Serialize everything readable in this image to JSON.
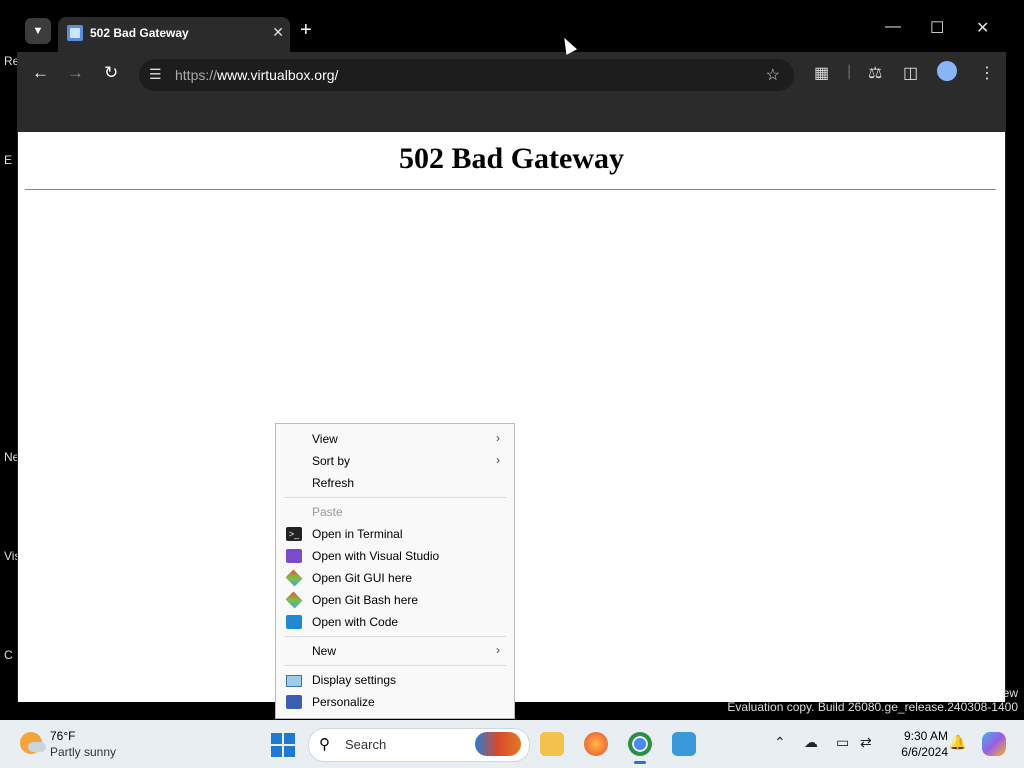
{
  "desktop": {
    "icon_labels": [
      "Re",
      "E",
      "Ne",
      "Vis",
      "C"
    ]
  },
  "browser": {
    "tab": {
      "title": "502 Bad Gateway"
    },
    "address": {
      "scheme": "https://",
      "host": "www.virtualbox.org/"
    },
    "icons": {
      "tab_search": "chevron-down-icon",
      "back": "arrow-left-icon",
      "forward": "arrow-right-icon",
      "reload": "reload-icon",
      "site_info": "tune-icon",
      "bookmark": "star-icon",
      "extensions": "puzzle-icon",
      "labs": "flask-icon",
      "side_panel": "side-panel-icon",
      "profile": "avatar-icon",
      "menu": "kebab-icon"
    }
  },
  "page": {
    "heading": "502 Bad Gateway"
  },
  "context_menu": {
    "items": [
      {
        "label": "View",
        "submenu": true
      },
      {
        "label": "Sort by",
        "submenu": true
      },
      {
        "label": "Refresh"
      },
      {
        "label": "Paste",
        "disabled": true
      },
      {
        "label": "Open in Terminal",
        "icon": "terminal-icon"
      },
      {
        "label": "Open with Visual Studio",
        "icon": "visual-studio-icon"
      },
      {
        "label": "Open Git GUI here",
        "icon": "git-icon"
      },
      {
        "label": "Open Git Bash here",
        "icon": "git-icon"
      },
      {
        "label": "Open with Code",
        "icon": "vscode-icon"
      },
      {
        "label": "New",
        "submenu": true
      },
      {
        "label": "Display settings",
        "icon": "display-icon"
      },
      {
        "label": "Personalize",
        "icon": "personalize-icon"
      }
    ]
  },
  "watermark": {
    "line1": "ew",
    "line2": "Evaluation copy. Build 26080.ge_release.240308-1400"
  },
  "taskbar": {
    "weather": {
      "temp": "76°F",
      "condition": "Partly sunny"
    },
    "search_label": "Search",
    "clock": {
      "time": "9:30 AM",
      "date": "6/6/2024"
    },
    "accent": "#1f78d1"
  }
}
